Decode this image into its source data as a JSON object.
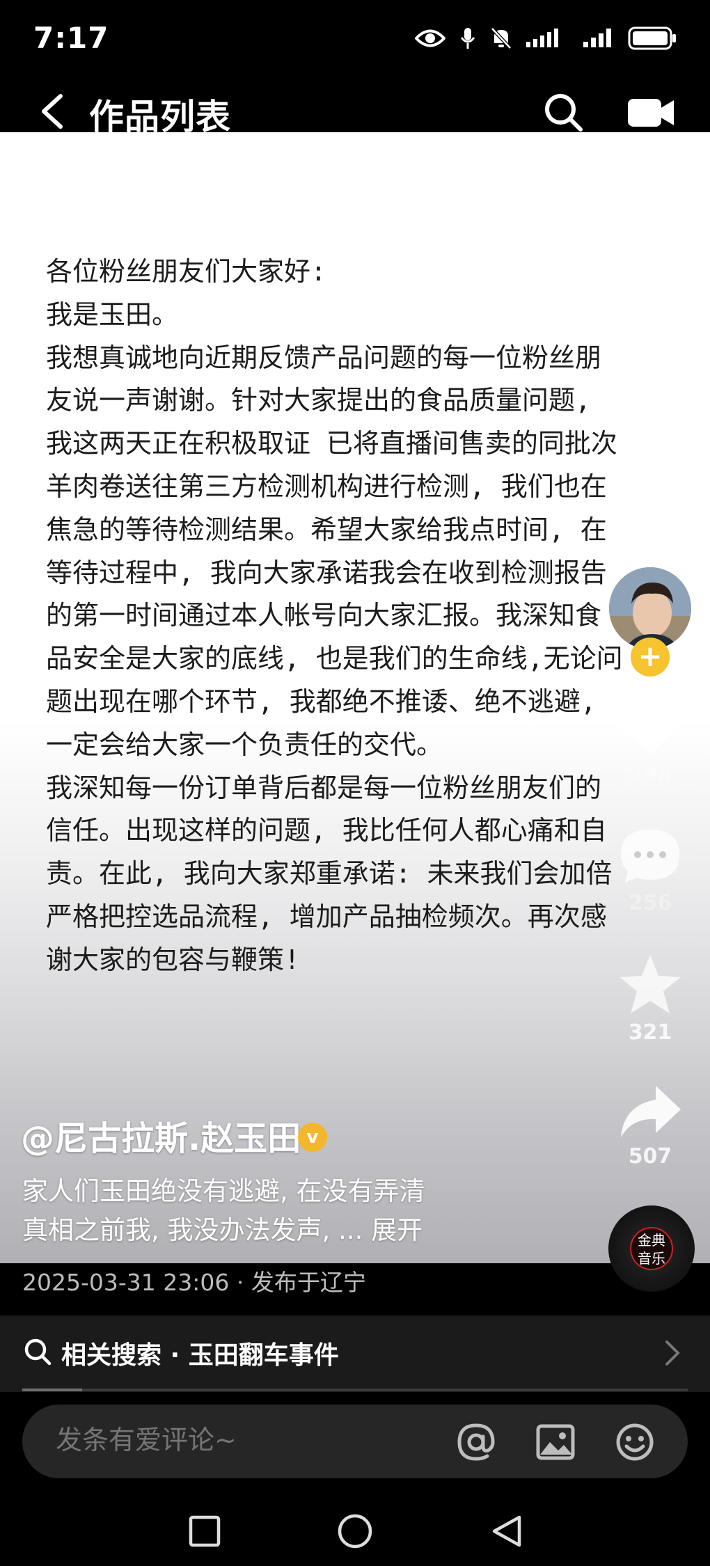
{
  "status_bar": {
    "time": "7:17"
  },
  "header": {
    "title": "作品列表"
  },
  "post": {
    "text": "各位粉丝朋友们大家好:\n我是玉田。\n我想真诚地向近期反馈产品问题的每一位粉丝朋\n友说一声谢谢。针对大家提出的食品质量问题,\n我这两天正在积极取证 已将直播间售卖的同批次\n羊肉卷送往第三方检测机构进行检测, 我们也在\n焦急的等待检测结果。希望大家给我点时间, 在\n等待过程中, 我向大家承诺我会在收到检测报告\n的第一时间通过本人帐号向大家汇报。我深知食\n品安全是大家的底线, 也是我们的生命线,无论问\n题出现在哪个环节, 我都绝不推诿、绝不逃避,\n一定会给大家一个负责任的交代。\n我深知每一份订单背后都是每一位粉丝朋友们的\n信任。出现这样的问题, 我比任何人都心痛和自\n责。在此, 我向大家郑重承诺: 未来我们会加倍\n严格把控选品流程, 增加产品抽检频次。再次感\n谢大家的包容与鞭策!"
  },
  "rail": {
    "follow_symbol": "+",
    "likes": "298",
    "comments": "256",
    "favorites": "321",
    "shares": "507"
  },
  "author": {
    "name": "@尼古拉斯.赵玉田",
    "verified_mark": "v"
  },
  "caption": {
    "line1": "家人们玉田绝没有逃避, 在没有弄清",
    "line2": "真相之前我, 我没办法发声, ...",
    "expand_label": "展开"
  },
  "music": {
    "label": "金典音乐"
  },
  "meta": {
    "timestamp": "2025-03-31 23:06",
    "separator": "·",
    "location": "发布于辽宁"
  },
  "related_search": {
    "label": "相关搜索 · 玉田翻车事件"
  },
  "progress": {
    "fraction": 0.09
  },
  "comment_bar": {
    "placeholder": "发条有爱评论~"
  },
  "colors": {
    "background": "#000000",
    "post_text": "#1c1c1c",
    "verified_badge": "#f4b62b",
    "follow_button": "#f7c32e"
  },
  "icons": [
    "back-icon",
    "search-icon",
    "video-icon",
    "heart-icon",
    "comment-icon",
    "star-icon",
    "share-icon",
    "at-icon",
    "image-icon",
    "emoji-icon",
    "square-nav-icon",
    "circle-nav-icon",
    "triangle-nav-icon"
  ]
}
